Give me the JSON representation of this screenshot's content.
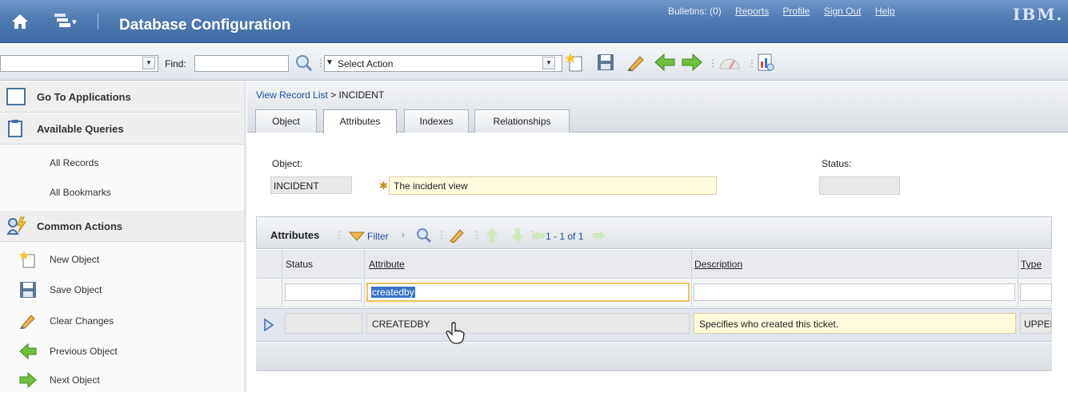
{
  "header": {
    "title": "Database Configuration",
    "links": [
      "Bulletins: (0)",
      "Reports",
      "Profile",
      "Sign Out",
      "Help"
    ],
    "logo": "IBM."
  },
  "toolbar": {
    "find_label": "Find:",
    "find_value": "",
    "select_action": "Select Action"
  },
  "nav": {
    "go_to_apps": "Go To Applications",
    "available_queries": "Available Queries",
    "queries": [
      "All Records",
      "All Bookmarks"
    ],
    "common_actions": "Common Actions",
    "actions": [
      "New Object",
      "Save Object",
      "Clear Changes",
      "Previous Object",
      "Next Object"
    ]
  },
  "breadcrumb": {
    "link": "View Record List",
    "current": "> INCIDENT"
  },
  "tabs": [
    "Object",
    "Attributes",
    "Indexes",
    "Relationships"
  ],
  "active_tab": "Attributes",
  "record": {
    "object_label": "Object:",
    "object_value": "INCIDENT",
    "description": "The incident view",
    "status_label": "Status:",
    "status_value": ""
  },
  "table": {
    "title": "Attributes",
    "filter_label": "Filter",
    "count": "1 - 1 of 1",
    "columns": [
      "Status",
      "Attribute",
      "Description",
      "Type"
    ],
    "filter_value": "createdby",
    "rows": [
      {
        "status": "",
        "attribute": "CREATEDBY",
        "description": "Specifies who created this ticket.",
        "type": "UPPER"
      }
    ]
  },
  "colors": {
    "header": "#4f7bb3",
    "link": "#1c4fa0",
    "highlight": "#fffbdc"
  }
}
